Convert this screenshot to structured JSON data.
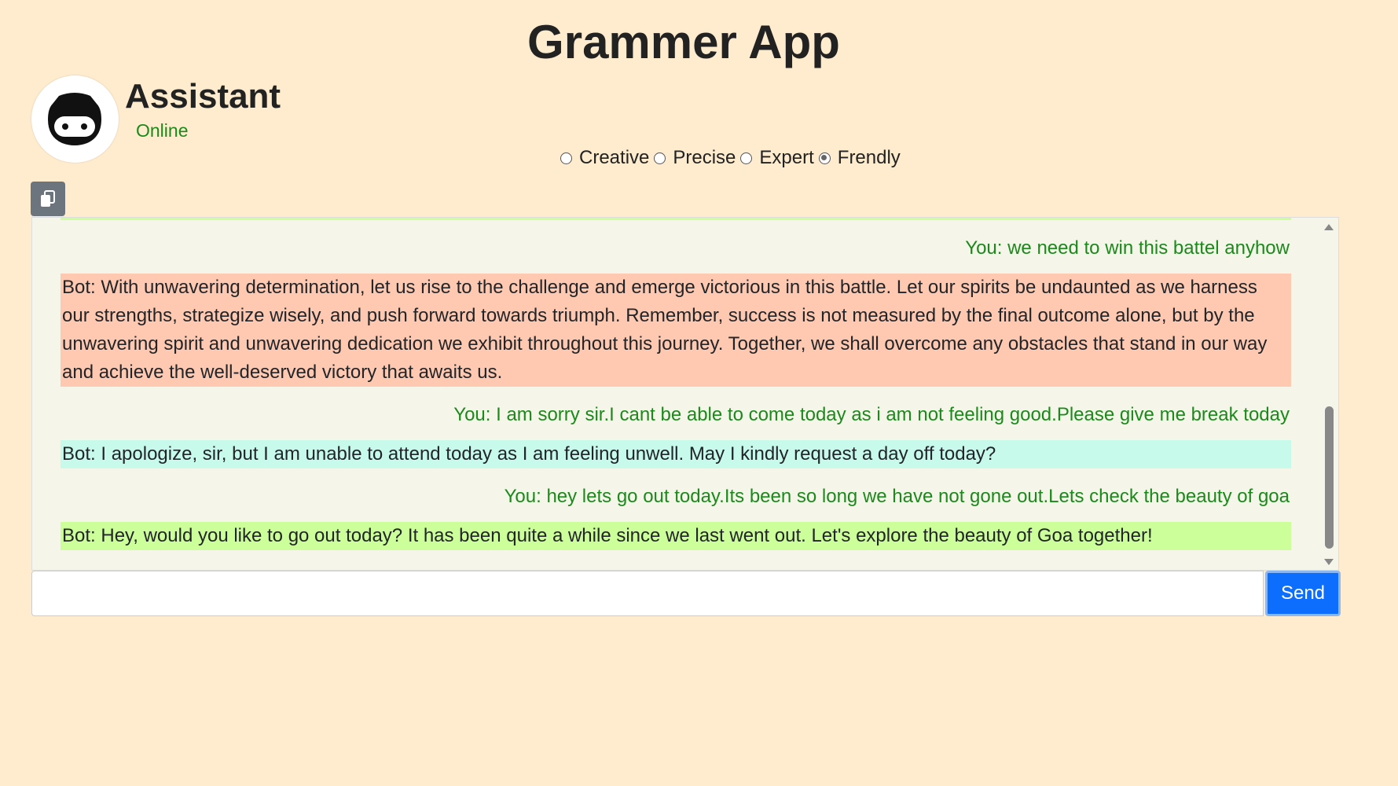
{
  "app": {
    "title": "Grammer App"
  },
  "assistant": {
    "name": "Assistant",
    "status": "Online"
  },
  "modes": {
    "options": [
      "Creative",
      "Precise",
      "Expert",
      "Frendly"
    ],
    "selected": "Frendly"
  },
  "toolbar": {
    "copy_icon": "copy-icon"
  },
  "messages": [
    {
      "role": "bot",
      "text": "",
      "color": "#ccff99"
    },
    {
      "role": "user",
      "text": "You: we need to win this battel anyhow"
    },
    {
      "role": "bot",
      "text": "Bot: With unwavering determination, let us rise to the challenge and emerge victorious in this battle. Let our spirits be undaunted as we harness our strengths, strategize wisely, and push forward towards triumph. Remember, success is not measured by the final outcome alone, but by the unwavering spirit and unwavering dedication we exhibit throughout this journey. Together, we shall overcome any obstacles that stand in our way and achieve the well-deserved victory that awaits us.",
      "color": "#ffc8b0"
    },
    {
      "role": "user",
      "text": "You: I am sorry sir.I cant be able to come today as i am not feeling good.Please give me break today"
    },
    {
      "role": "bot",
      "text": "Bot: I apologize, sir, but I am unable to attend today as I am feeling unwell. May I kindly request a day off today?",
      "color": "#c8faeb"
    },
    {
      "role": "user",
      "text": "You: hey lets go out today.Its been so long we have not gone out.Lets check the beauty of goa"
    },
    {
      "role": "bot",
      "text": "Bot: Hey, would you like to go out today? It has been quite a while since we last went out. Let's explore the beauty of Goa together!",
      "color": "#ccff99"
    }
  ],
  "input": {
    "value": "",
    "placeholder": ""
  },
  "send": {
    "label": "Send"
  },
  "colors": {
    "background": "#ffebcd",
    "user_text": "#1a8a1a",
    "send_button": "#0d6efd"
  }
}
